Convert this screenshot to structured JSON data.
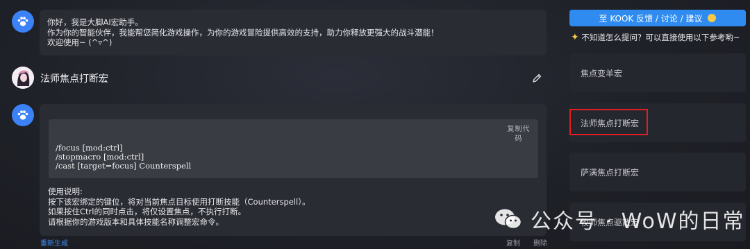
{
  "chat": {
    "welcome": {
      "line1": "你好，我是大脚AI宏助手。",
      "line2": "作为你的智能伙伴，我能帮您简化游戏操作，为你的游戏冒险提供高效的支持，助力你释放更强大的战斗潜能！",
      "line3": "欢迎使用~ (^▿^)"
    },
    "user_query": "法师焦点打断宏",
    "answer": {
      "copy_code_label": "复制代码",
      "code": [
        "/focus [mod:ctrl]",
        "/stopmacro [mod:ctrl]",
        "/cast [target=focus] Counterspell"
      ],
      "usage_title": "使用说明:",
      "usage_lines": [
        "按下该宏绑定的键位，将对当前焦点目标使用打断技能（Counterspell）。",
        "如果按住Ctrl的同时点击，将仅设置焦点，不执行打断。",
        "请根据你的游戏版本和具体技能名称调整宏命令。"
      ],
      "regenerate": "重新生成",
      "copy": "复制",
      "delete": "删除"
    }
  },
  "sidebar": {
    "feedback_button": "至 KOOK 反馈 / 讨论 / 建议",
    "hint": "不知道怎么提问？可以直接使用以下参考哟~",
    "suggestions": [
      "焦点变羊宏",
      "法师焦点打断宏",
      "萨满焦点打断宏",
      "牧师焦点驱散宏"
    ]
  },
  "watermark": "公众号 · WoW的日常",
  "colors": {
    "accent": "#2f8bf0",
    "highlight": "#e02020"
  }
}
